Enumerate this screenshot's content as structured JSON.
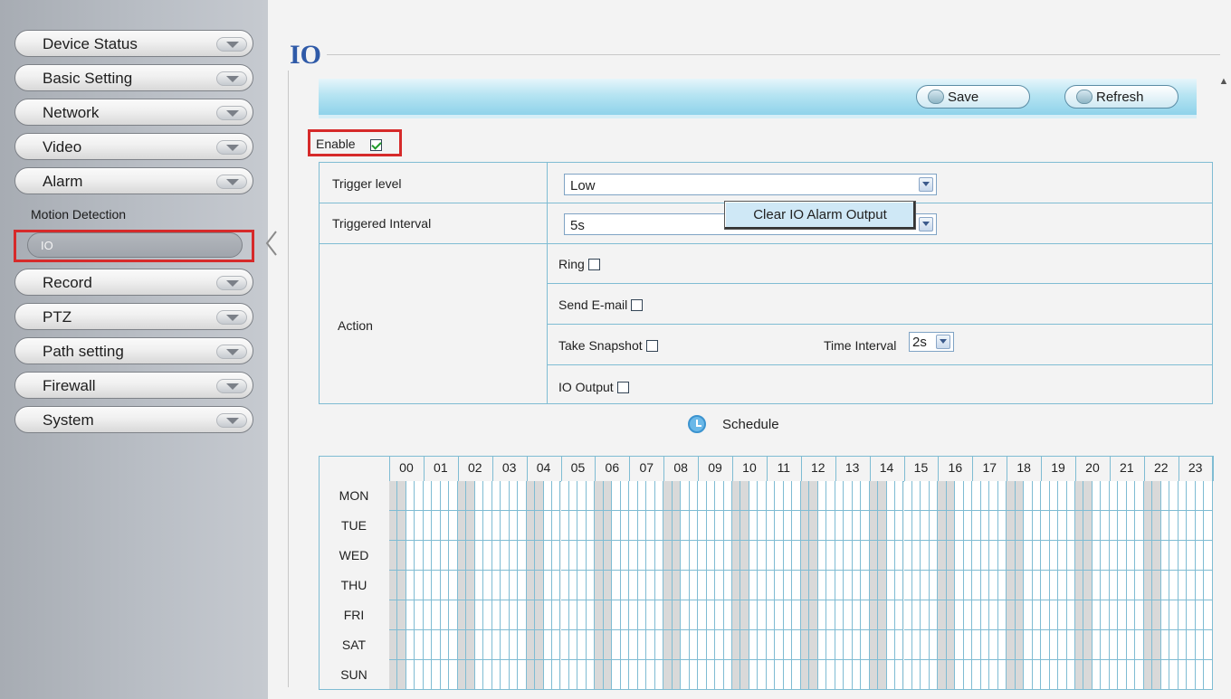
{
  "sidebar": {
    "items": [
      {
        "label": "Device Status"
      },
      {
        "label": "Basic Setting"
      },
      {
        "label": "Network"
      },
      {
        "label": "Video"
      },
      {
        "label": "Alarm"
      }
    ],
    "alarm_sub": {
      "motion_detection": "Motion Detection",
      "io": "IO"
    },
    "items_after": [
      {
        "label": "Record"
      },
      {
        "label": "PTZ"
      },
      {
        "label": "Path setting"
      },
      {
        "label": "Firewall"
      },
      {
        "label": "System"
      }
    ]
  },
  "page": {
    "title": "IO",
    "toolbar": {
      "save_label": "Save",
      "refresh_label": "Refresh"
    },
    "enable": {
      "label": "Enable",
      "checked": true
    }
  },
  "settings": {
    "trigger_level": {
      "label": "Trigger level",
      "value": "Low"
    },
    "triggered_interval": {
      "label": "Triggered Interval",
      "value": "5s"
    },
    "action": {
      "label": "Action",
      "ring": "Ring",
      "send_email": "Send E-mail",
      "take_snapshot": "Take Snapshot",
      "time_interval_label": "Time Interval",
      "time_interval_value": "2s",
      "io_output": "IO Output",
      "clear_button": "Clear IO Alarm Output"
    }
  },
  "schedule": {
    "label": "Schedule",
    "hours": [
      "00",
      "01",
      "02",
      "03",
      "04",
      "05",
      "06",
      "07",
      "08",
      "09",
      "10",
      "11",
      "12",
      "13",
      "14",
      "15",
      "16",
      "17",
      "18",
      "19",
      "20",
      "21",
      "22",
      "23"
    ],
    "days": [
      "MON",
      "TUE",
      "WED",
      "THU",
      "FRI",
      "SAT",
      "SUN"
    ]
  },
  "colors": {
    "title": "#2f5aa8",
    "highlight": "#d62a2a",
    "grid_line": "#7fbcd3",
    "grid_shade": "#d9d9d9"
  }
}
